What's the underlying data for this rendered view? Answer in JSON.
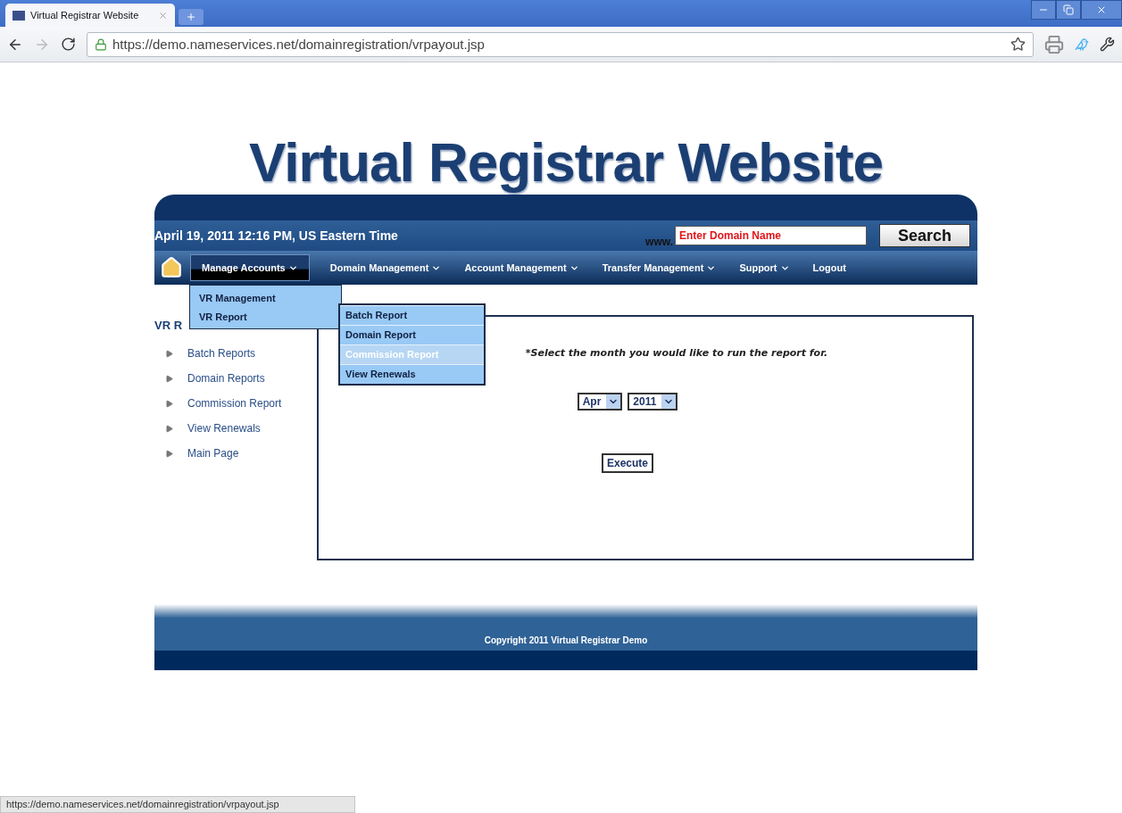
{
  "browser": {
    "tab": {
      "title": "Virtual Registrar Website",
      "selected": true
    },
    "url": "https://demo.nameservices.net/domainregistration/vrpayout.jsp",
    "status_url": "https://demo.nameservices.net/domainregistration/vrpayout.jsp"
  },
  "page": {
    "title": "Virtual Registrar Website",
    "date_time": "April 19, 2011 12:16 PM, US Eastern Time",
    "search": {
      "prefix": "www.",
      "placeholder": "Enter Domain Name",
      "button": "Search"
    },
    "nav": [
      {
        "label": "Manage Accounts",
        "caret": true,
        "selected": true
      },
      {
        "label": "Domain Management",
        "caret": true,
        "selected": false
      },
      {
        "label": "Account Management",
        "caret": true,
        "selected": false
      },
      {
        "label": "Transfer Management",
        "caret": true,
        "selected": false
      },
      {
        "label": "Support",
        "caret": true,
        "selected": false
      },
      {
        "label": "Logout",
        "caret": false,
        "selected": false
      }
    ],
    "menu": [
      {
        "label": "VR Management",
        "selected": false
      },
      {
        "label": "VR Report",
        "selected": false
      }
    ],
    "submenu": [
      {
        "label": "Batch Report",
        "selected": false
      },
      {
        "label": "Domain Report",
        "selected": false
      },
      {
        "label": "Commission Report",
        "selected": true
      },
      {
        "label": "View Renewals",
        "selected": false
      }
    ],
    "sidebar": {
      "heading": "VR R",
      "items": [
        "Batch Reports",
        "Domain Reports",
        "Commission Report",
        "View Renewals",
        "Main Page"
      ]
    },
    "report": {
      "instruction": "*Select the month you would like to run the report for.",
      "month": "Apr",
      "year": "2011",
      "button": "Execute"
    },
    "footer": "Copyright 2011 Virtual Registrar Demo"
  }
}
